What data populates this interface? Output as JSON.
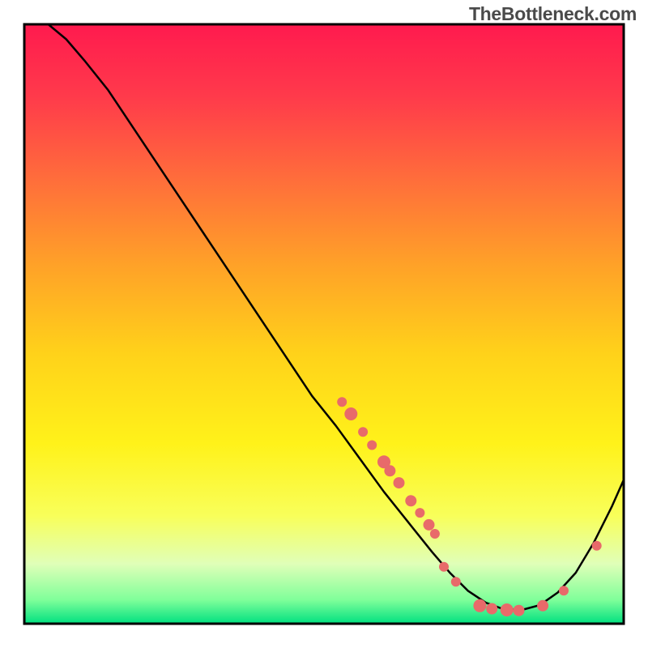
{
  "watermark": "TheBottleneck.com",
  "chart_data": {
    "type": "line",
    "title": "",
    "xlabel": "",
    "ylabel": "",
    "xlim": [
      0,
      100
    ],
    "ylim": [
      0,
      100
    ],
    "grid": false,
    "legend": false,
    "background_gradient": {
      "stops": [
        {
          "offset": 0.0,
          "color": "#ff1a4e"
        },
        {
          "offset": 0.12,
          "color": "#ff3a4b"
        },
        {
          "offset": 0.25,
          "color": "#ff6a3c"
        },
        {
          "offset": 0.4,
          "color": "#ffa128"
        },
        {
          "offset": 0.55,
          "color": "#ffd21a"
        },
        {
          "offset": 0.7,
          "color": "#fff21a"
        },
        {
          "offset": 0.82,
          "color": "#f8ff5a"
        },
        {
          "offset": 0.9,
          "color": "#e0ffb8"
        },
        {
          "offset": 0.96,
          "color": "#80ff9a"
        },
        {
          "offset": 1.0,
          "color": "#00e080"
        }
      ]
    },
    "curve": [
      {
        "x": 4.0,
        "y": 100.0
      },
      {
        "x": 7.0,
        "y": 97.5
      },
      {
        "x": 10.0,
        "y": 94.0
      },
      {
        "x": 14.0,
        "y": 89.0
      },
      {
        "x": 18.0,
        "y": 83.0
      },
      {
        "x": 24.0,
        "y": 74.0
      },
      {
        "x": 30.0,
        "y": 65.0
      },
      {
        "x": 36.0,
        "y": 56.0
      },
      {
        "x": 42.0,
        "y": 47.0
      },
      {
        "x": 48.0,
        "y": 38.0
      },
      {
        "x": 52.0,
        "y": 33.0
      },
      {
        "x": 56.0,
        "y": 27.5
      },
      {
        "x": 60.0,
        "y": 22.0
      },
      {
        "x": 64.0,
        "y": 17.0
      },
      {
        "x": 68.0,
        "y": 12.0
      },
      {
        "x": 71.0,
        "y": 8.5
      },
      {
        "x": 74.0,
        "y": 5.5
      },
      {
        "x": 77.0,
        "y": 3.5
      },
      {
        "x": 80.0,
        "y": 2.4
      },
      {
        "x": 83.0,
        "y": 2.3
      },
      {
        "x": 86.0,
        "y": 3.1
      },
      {
        "x": 89.0,
        "y": 5.2
      },
      {
        "x": 92.0,
        "y": 8.5
      },
      {
        "x": 95.0,
        "y": 13.5
      },
      {
        "x": 98.0,
        "y": 19.5
      },
      {
        "x": 100.0,
        "y": 24.0
      }
    ],
    "points": [
      {
        "x": 53.0,
        "y": 37.0,
        "r": 6
      },
      {
        "x": 54.5,
        "y": 35.0,
        "r": 8
      },
      {
        "x": 56.5,
        "y": 32.0,
        "r": 6
      },
      {
        "x": 58.0,
        "y": 29.8,
        "r": 6
      },
      {
        "x": 60.0,
        "y": 27.0,
        "r": 8
      },
      {
        "x": 61.0,
        "y": 25.5,
        "r": 7
      },
      {
        "x": 62.5,
        "y": 23.5,
        "r": 7
      },
      {
        "x": 64.5,
        "y": 20.5,
        "r": 7
      },
      {
        "x": 66.0,
        "y": 18.5,
        "r": 6
      },
      {
        "x": 67.5,
        "y": 16.5,
        "r": 7
      },
      {
        "x": 68.5,
        "y": 15.0,
        "r": 6
      },
      {
        "x": 70.0,
        "y": 9.5,
        "r": 6
      },
      {
        "x": 72.0,
        "y": 7.0,
        "r": 6
      },
      {
        "x": 76.0,
        "y": 3.0,
        "r": 8
      },
      {
        "x": 78.0,
        "y": 2.5,
        "r": 7
      },
      {
        "x": 80.5,
        "y": 2.3,
        "r": 8
      },
      {
        "x": 82.5,
        "y": 2.2,
        "r": 7
      },
      {
        "x": 86.5,
        "y": 3.0,
        "r": 7
      },
      {
        "x": 90.0,
        "y": 5.5,
        "r": 6
      },
      {
        "x": 95.5,
        "y": 13.0,
        "r": 6
      }
    ],
    "point_color": "#e86a6a",
    "curve_color": "#000000",
    "frame_color": "#000000"
  }
}
